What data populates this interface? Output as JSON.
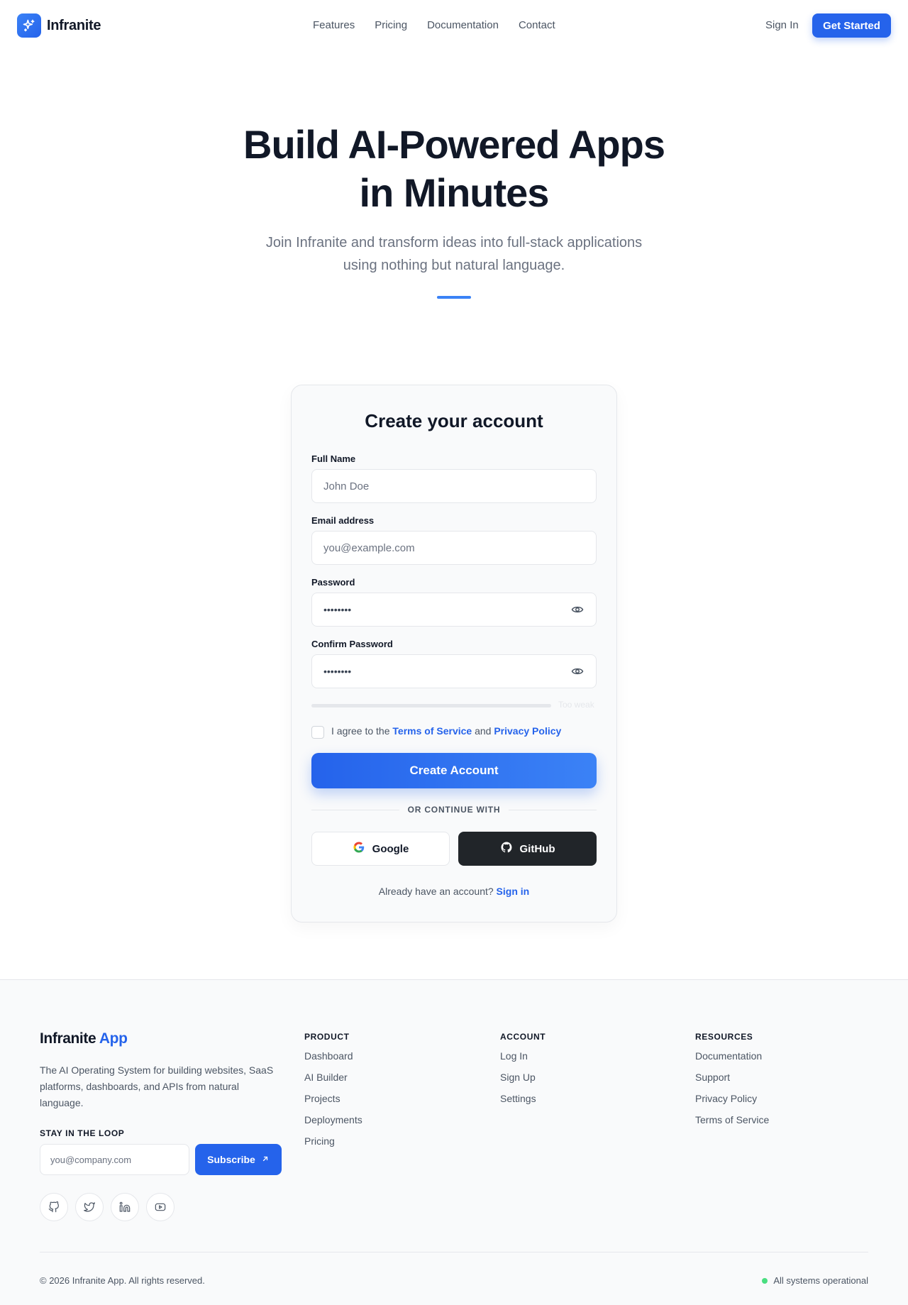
{
  "header": {
    "brand": "Infranite",
    "nav": [
      "Features",
      "Pricing",
      "Documentation",
      "Contact"
    ],
    "sign_in": "Sign In",
    "get_started": "Get Started"
  },
  "hero": {
    "title_line1": "Build AI-Powered Apps",
    "title_line2": "in Minutes",
    "subtitle_line1": "Join Infranite and transform ideas into full-stack applications",
    "subtitle_line2": "using nothing but natural language."
  },
  "signup": {
    "title": "Create your account",
    "full_name_label": "Full Name",
    "full_name_placeholder": "John Doe",
    "email_label": "Email address",
    "email_placeholder": "you@example.com",
    "password_label": "Password",
    "password_value": "••••••••",
    "confirm_label": "Confirm Password",
    "confirm_value": "••••••••",
    "strength_text": "Too weak",
    "agree_prefix": "I agree to the",
    "terms_link": "Terms of Service",
    "agree_and": "and",
    "privacy_link": "Privacy Policy",
    "create_button": "Create Account",
    "divider_text": "OR CONTINUE WITH",
    "google_label": "Google",
    "github_label": "GitHub",
    "already_text": "Already have an account?",
    "sign_in_link": "Sign in"
  },
  "footer": {
    "brand_main": "Infranite",
    "brand_accent": "App",
    "description": "The AI Operating System for building websites, SaaS platforms, dashboards, and APIs from natural language.",
    "newsletter_heading": "STAY IN THE LOOP",
    "newsletter_placeholder": "you@company.com",
    "subscribe_label": "Subscribe",
    "columns": [
      {
        "heading": "PRODUCT",
        "links": [
          "Dashboard",
          "AI Builder",
          "Projects",
          "Deployments",
          "Pricing"
        ]
      },
      {
        "heading": "ACCOUNT",
        "links": [
          "Log In",
          "Sign Up",
          "Settings"
        ]
      },
      {
        "heading": "RESOURCES",
        "links": [
          "Documentation",
          "Support",
          "Privacy Policy",
          "Terms of Service"
        ]
      }
    ],
    "social_icons": [
      "github-icon",
      "twitter-icon",
      "linkedin-icon",
      "youtube-icon"
    ],
    "copyright": "© 2026 Infranite App. All rights reserved.",
    "status": "All systems operational"
  },
  "colors": {
    "accent": "#2563eb",
    "text": "#111827",
    "muted": "#4b5563",
    "status_ok": "#4ade80"
  }
}
